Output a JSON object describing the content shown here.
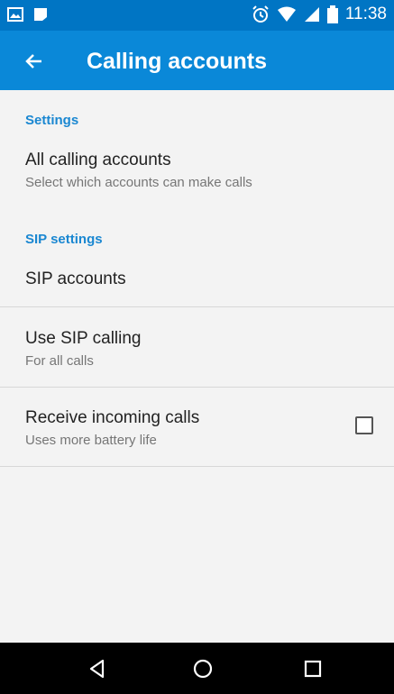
{
  "status_bar": {
    "time": "11:38",
    "icons": [
      "picture-icon",
      "notification-icon",
      "alarm-icon",
      "wifi-icon",
      "signal-icon",
      "battery-icon"
    ]
  },
  "toolbar": {
    "title": "Calling accounts",
    "back_icon": "back-arrow-icon"
  },
  "sections": [
    {
      "header": "Settings",
      "items": [
        {
          "title": "All calling accounts",
          "subtitle": "Select which accounts can make calls"
        }
      ]
    },
    {
      "header": "SIP settings",
      "items": [
        {
          "title": "SIP accounts"
        },
        {
          "title": "Use SIP calling",
          "subtitle": "For all calls"
        },
        {
          "title": "Receive incoming calls",
          "subtitle": "Uses more battery life",
          "checkbox": false
        }
      ]
    }
  ],
  "navbar": {
    "icons": [
      "back-triangle-icon",
      "home-circle-icon",
      "recents-square-icon"
    ]
  },
  "colors": {
    "status_bar": "#0075c4",
    "toolbar": "#0a88d8",
    "section_header": "#1a87d1",
    "background": "#f3f3f3"
  }
}
